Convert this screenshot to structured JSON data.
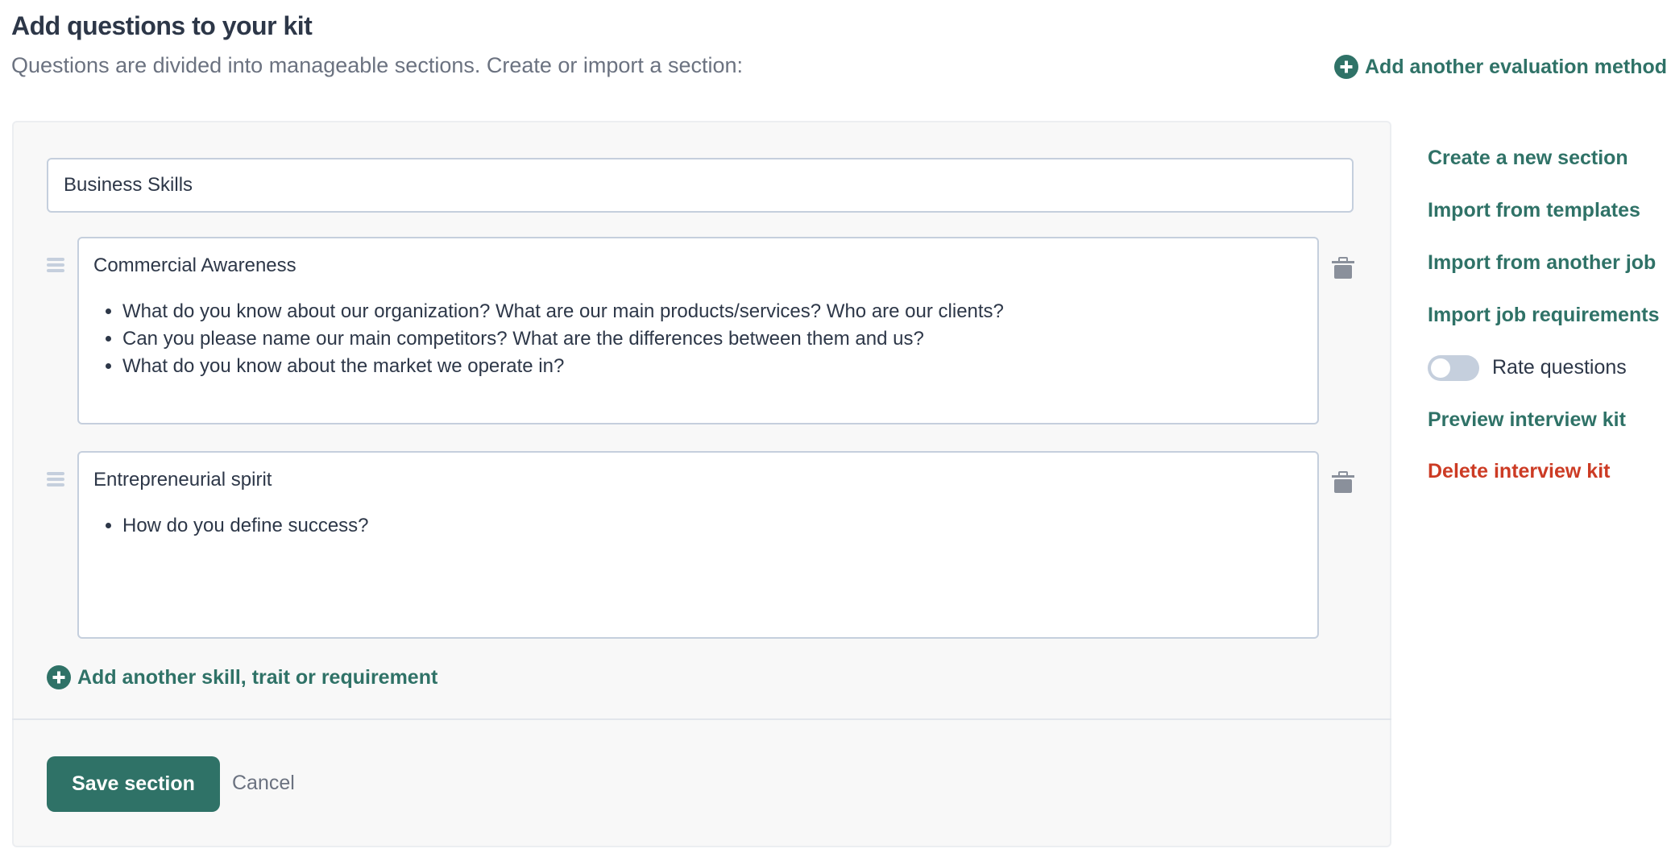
{
  "header": {
    "title": "Add questions to your kit",
    "subtitle": "Questions are divided into manageable sections. Create or import a section:",
    "add_eval": "Add another evaluation method"
  },
  "section": {
    "name": "Business Skills",
    "cards": [
      {
        "title": "Commercial Awareness",
        "questions": [
          "What do you know about our organization? What are our main products/services? Who are our clients?",
          "Can you please name our main competitors? What are the differences between them and us?",
          "What do you know about the market we operate in?"
        ]
      },
      {
        "title": "Entrepreneurial spirit",
        "questions": [
          "How do you define success?"
        ]
      }
    ],
    "add_skill": "Add another skill, trait or requirement",
    "save": "Save section",
    "cancel": "Cancel"
  },
  "sidebar": {
    "create": "Create a new section",
    "import_templates": "Import from templates",
    "import_job": "Import from another job",
    "import_requirements": "Import job requirements",
    "rate_label": "Rate questions",
    "rate_enabled": false,
    "preview": "Preview interview kit",
    "delete": "Delete interview kit"
  },
  "colors": {
    "accent": "#2f7267",
    "danger": "#cc3b24"
  }
}
